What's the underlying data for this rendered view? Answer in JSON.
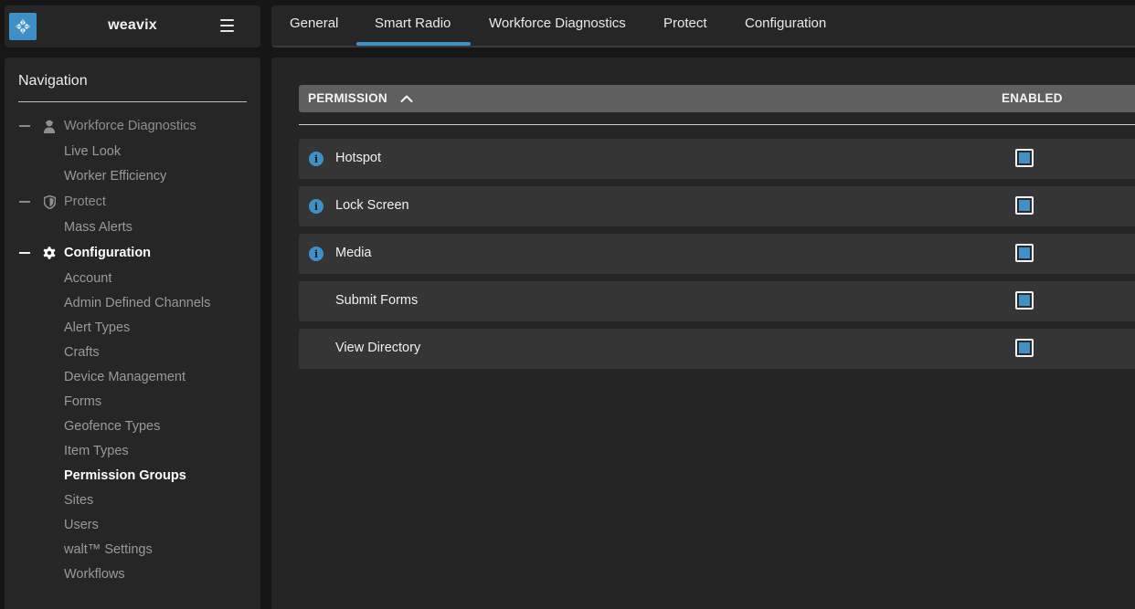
{
  "brand": {
    "name": "weavix"
  },
  "tabs": [
    {
      "label": "General"
    },
    {
      "label": "Smart Radio",
      "active": true
    },
    {
      "label": "Workforce Diagnostics"
    },
    {
      "label": "Protect"
    },
    {
      "label": "Configuration"
    }
  ],
  "sidebar": {
    "title": "Navigation",
    "sections": [
      {
        "label": "Workforce Diagnostics",
        "icon": "worker-icon",
        "items": [
          "Live Look",
          "Worker Efficiency"
        ]
      },
      {
        "label": "Protect",
        "icon": "shield-icon",
        "items": [
          "Mass Alerts"
        ]
      },
      {
        "label": "Configuration",
        "icon": "gear-icon",
        "active": true,
        "items": [
          "Account",
          "Admin Defined Channels",
          "Alert Types",
          "Crafts",
          "Device Management",
          "Forms",
          "Geofence Types",
          "Item Types",
          "Permission Groups",
          "Sites",
          "Users",
          "walt™ Settings",
          "Workflows"
        ],
        "active_item": "Permission Groups"
      }
    ]
  },
  "table": {
    "columns": {
      "permission": "PERMISSION",
      "enabled": "ENABLED"
    },
    "sort": "ascending",
    "rows": [
      {
        "label": "Hotspot",
        "info": true,
        "enabled": true
      },
      {
        "label": "Lock Screen",
        "info": true,
        "enabled": true
      },
      {
        "label": "Media",
        "info": true,
        "enabled": true
      },
      {
        "label": "Submit Forms",
        "info": false,
        "enabled": true
      },
      {
        "label": "View Directory",
        "info": false,
        "enabled": true
      }
    ]
  },
  "colors": {
    "accent": "#3e92c9",
    "background": "#161616",
    "panel": "#262626",
    "row": "#353535",
    "header": "#5f5f5f"
  }
}
